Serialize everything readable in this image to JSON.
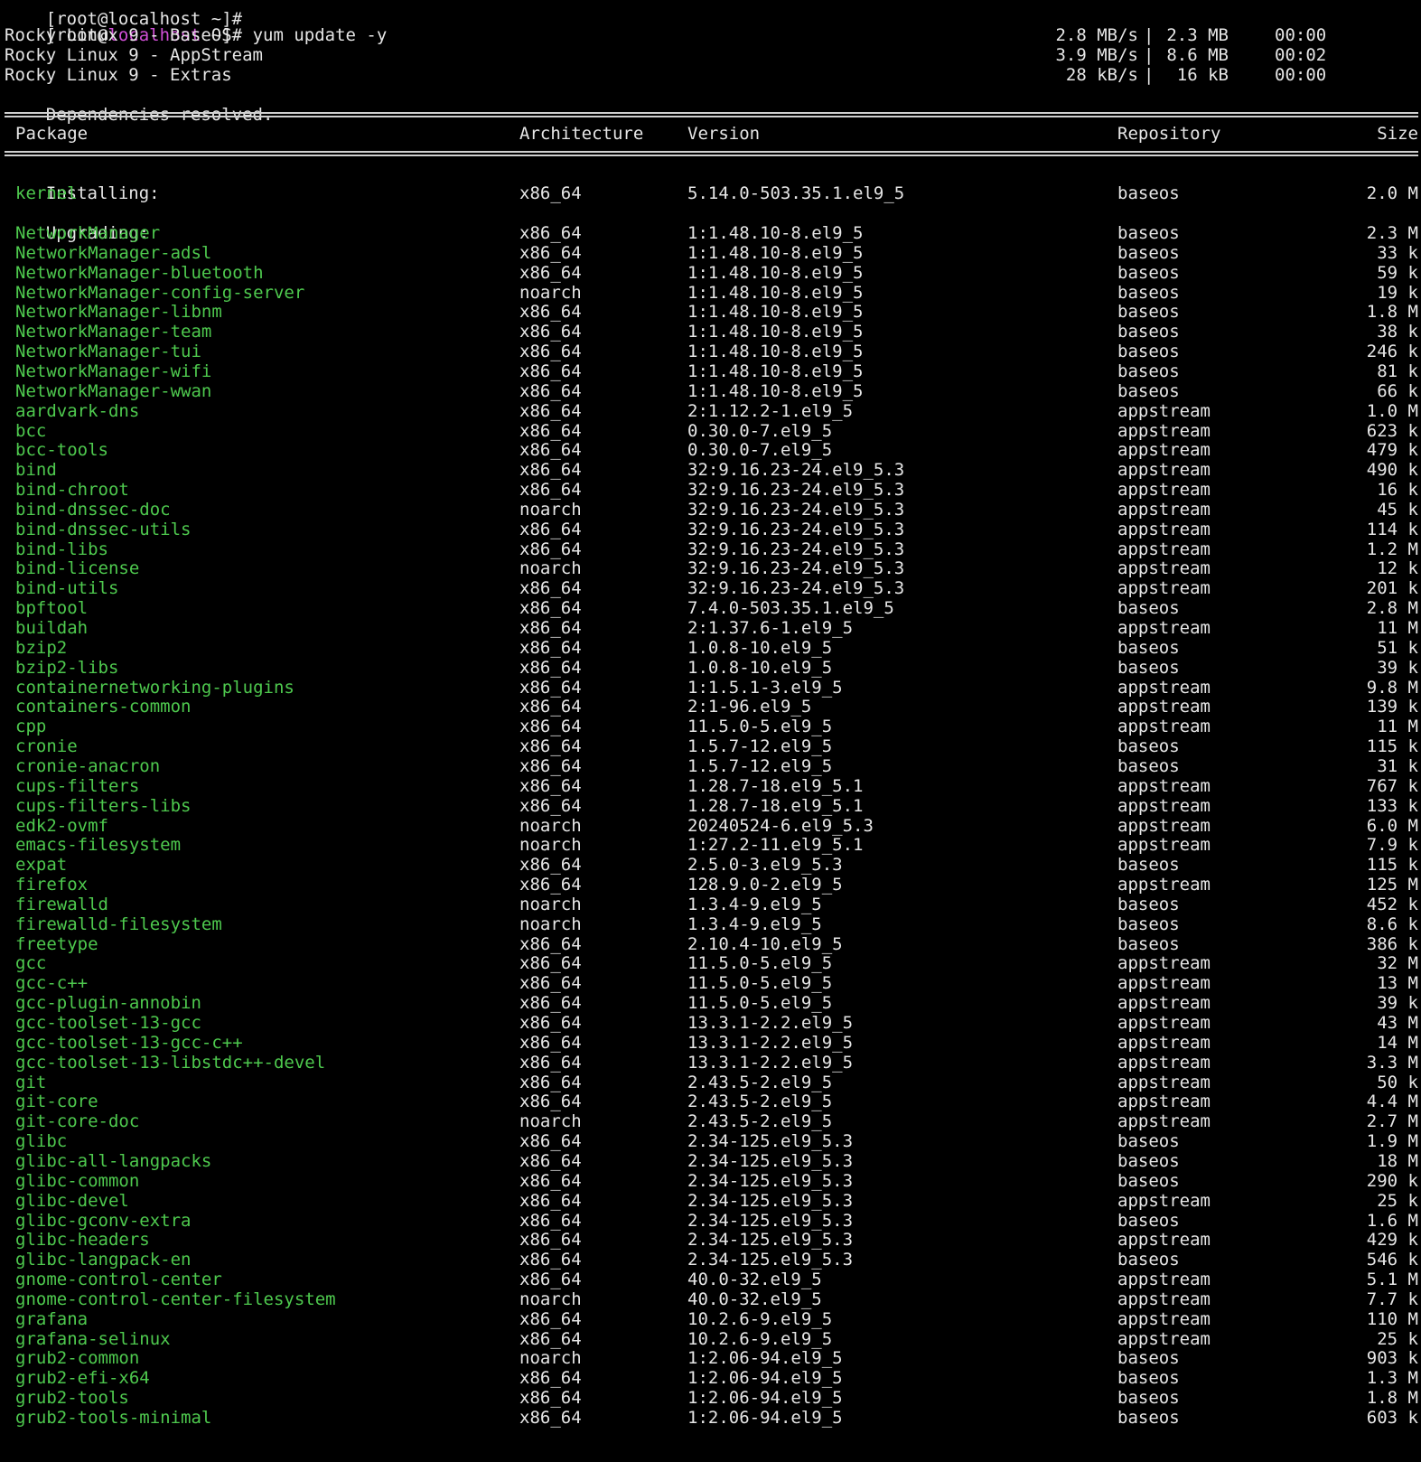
{
  "terminal": {
    "prompt_partial_top": "[root@localhost ~]#",
    "prompt": {
      "open": "[root@",
      "host": "localhost",
      "rest": " ~]# ",
      "command": "yum update -y"
    },
    "repos": [
      {
        "name": "Rocky Linux 9 - BaseOS",
        "speed": "2.8 MB/s",
        "size": "2.3 MB",
        "time": "00:00"
      },
      {
        "name": "Rocky Linux 9 - AppStream",
        "speed": "3.9 MB/s",
        "size": "8.6 MB",
        "time": "00:02"
      },
      {
        "name": "Rocky Linux 9 - Extras",
        "speed": "28 kB/s",
        "size": "16 kB",
        "time": "00:00"
      }
    ],
    "status": "Dependencies resolved.",
    "header": {
      "package": "Package",
      "arch": "Architecture",
      "version": "Version",
      "repo": "Repository",
      "size": "Size"
    },
    "section_installing": "Installing:",
    "installing": [
      {
        "name": "kernel",
        "arch": "x86_64",
        "version": "5.14.0-503.35.1.el9_5",
        "repo": "baseos",
        "size": "2.0 M"
      }
    ],
    "section_upgrading": "Upgrading:",
    "upgrading": [
      {
        "name": "NetworkManager",
        "arch": "x86_64",
        "version": "1:1.48.10-8.el9_5",
        "repo": "baseos",
        "size": "2.3 M"
      },
      {
        "name": "NetworkManager-adsl",
        "arch": "x86_64",
        "version": "1:1.48.10-8.el9_5",
        "repo": "baseos",
        "size": "33 k"
      },
      {
        "name": "NetworkManager-bluetooth",
        "arch": "x86_64",
        "version": "1:1.48.10-8.el9_5",
        "repo": "baseos",
        "size": "59 k"
      },
      {
        "name": "NetworkManager-config-server",
        "arch": "noarch",
        "version": "1:1.48.10-8.el9_5",
        "repo": "baseos",
        "size": "19 k"
      },
      {
        "name": "NetworkManager-libnm",
        "arch": "x86_64",
        "version": "1:1.48.10-8.el9_5",
        "repo": "baseos",
        "size": "1.8 M"
      },
      {
        "name": "NetworkManager-team",
        "arch": "x86_64",
        "version": "1:1.48.10-8.el9_5",
        "repo": "baseos",
        "size": "38 k"
      },
      {
        "name": "NetworkManager-tui",
        "arch": "x86_64",
        "version": "1:1.48.10-8.el9_5",
        "repo": "baseos",
        "size": "246 k"
      },
      {
        "name": "NetworkManager-wifi",
        "arch": "x86_64",
        "version": "1:1.48.10-8.el9_5",
        "repo": "baseos",
        "size": "81 k"
      },
      {
        "name": "NetworkManager-wwan",
        "arch": "x86_64",
        "version": "1:1.48.10-8.el9_5",
        "repo": "baseos",
        "size": "66 k"
      },
      {
        "name": "aardvark-dns",
        "arch": "x86_64",
        "version": "2:1.12.2-1.el9_5",
        "repo": "appstream",
        "size": "1.0 M"
      },
      {
        "name": "bcc",
        "arch": "x86_64",
        "version": "0.30.0-7.el9_5",
        "repo": "appstream",
        "size": "623 k"
      },
      {
        "name": "bcc-tools",
        "arch": "x86_64",
        "version": "0.30.0-7.el9_5",
        "repo": "appstream",
        "size": "479 k"
      },
      {
        "name": "bind",
        "arch": "x86_64",
        "version": "32:9.16.23-24.el9_5.3",
        "repo": "appstream",
        "size": "490 k"
      },
      {
        "name": "bind-chroot",
        "arch": "x86_64",
        "version": "32:9.16.23-24.el9_5.3",
        "repo": "appstream",
        "size": "16 k"
      },
      {
        "name": "bind-dnssec-doc",
        "arch": "noarch",
        "version": "32:9.16.23-24.el9_5.3",
        "repo": "appstream",
        "size": "45 k"
      },
      {
        "name": "bind-dnssec-utils",
        "arch": "x86_64",
        "version": "32:9.16.23-24.el9_5.3",
        "repo": "appstream",
        "size": "114 k"
      },
      {
        "name": "bind-libs",
        "arch": "x86_64",
        "version": "32:9.16.23-24.el9_5.3",
        "repo": "appstream",
        "size": "1.2 M"
      },
      {
        "name": "bind-license",
        "arch": "noarch",
        "version": "32:9.16.23-24.el9_5.3",
        "repo": "appstream",
        "size": "12 k"
      },
      {
        "name": "bind-utils",
        "arch": "x86_64",
        "version": "32:9.16.23-24.el9_5.3",
        "repo": "appstream",
        "size": "201 k"
      },
      {
        "name": "bpftool",
        "arch": "x86_64",
        "version": "7.4.0-503.35.1.el9_5",
        "repo": "baseos",
        "size": "2.8 M"
      },
      {
        "name": "buildah",
        "arch": "x86_64",
        "version": "2:1.37.6-1.el9_5",
        "repo": "appstream",
        "size": "11 M"
      },
      {
        "name": "bzip2",
        "arch": "x86_64",
        "version": "1.0.8-10.el9_5",
        "repo": "baseos",
        "size": "51 k"
      },
      {
        "name": "bzip2-libs",
        "arch": "x86_64",
        "version": "1.0.8-10.el9_5",
        "repo": "baseos",
        "size": "39 k"
      },
      {
        "name": "containernetworking-plugins",
        "arch": "x86_64",
        "version": "1:1.5.1-3.el9_5",
        "repo": "appstream",
        "size": "9.8 M"
      },
      {
        "name": "containers-common",
        "arch": "x86_64",
        "version": "2:1-96.el9_5",
        "repo": "appstream",
        "size": "139 k"
      },
      {
        "name": "cpp",
        "arch": "x86_64",
        "version": "11.5.0-5.el9_5",
        "repo": "appstream",
        "size": "11 M"
      },
      {
        "name": "cronie",
        "arch": "x86_64",
        "version": "1.5.7-12.el9_5",
        "repo": "baseos",
        "size": "115 k"
      },
      {
        "name": "cronie-anacron",
        "arch": "x86_64",
        "version": "1.5.7-12.el9_5",
        "repo": "baseos",
        "size": "31 k"
      },
      {
        "name": "cups-filters",
        "arch": "x86_64",
        "version": "1.28.7-18.el9_5.1",
        "repo": "appstream",
        "size": "767 k"
      },
      {
        "name": "cups-filters-libs",
        "arch": "x86_64",
        "version": "1.28.7-18.el9_5.1",
        "repo": "appstream",
        "size": "133 k"
      },
      {
        "name": "edk2-ovmf",
        "arch": "noarch",
        "version": "20240524-6.el9_5.3",
        "repo": "appstream",
        "size": "6.0 M"
      },
      {
        "name": "emacs-filesystem",
        "arch": "noarch",
        "version": "1:27.2-11.el9_5.1",
        "repo": "appstream",
        "size": "7.9 k"
      },
      {
        "name": "expat",
        "arch": "x86_64",
        "version": "2.5.0-3.el9_5.3",
        "repo": "baseos",
        "size": "115 k"
      },
      {
        "name": "firefox",
        "arch": "x86_64",
        "version": "128.9.0-2.el9_5",
        "repo": "appstream",
        "size": "125 M"
      },
      {
        "name": "firewalld",
        "arch": "noarch",
        "version": "1.3.4-9.el9_5",
        "repo": "baseos",
        "size": "452 k"
      },
      {
        "name": "firewalld-filesystem",
        "arch": "noarch",
        "version": "1.3.4-9.el9_5",
        "repo": "baseos",
        "size": "8.6 k"
      },
      {
        "name": "freetype",
        "arch": "x86_64",
        "version": "2.10.4-10.el9_5",
        "repo": "baseos",
        "size": "386 k"
      },
      {
        "name": "gcc",
        "arch": "x86_64",
        "version": "11.5.0-5.el9_5",
        "repo": "appstream",
        "size": "32 M"
      },
      {
        "name": "gcc-c++",
        "arch": "x86_64",
        "version": "11.5.0-5.el9_5",
        "repo": "appstream",
        "size": "13 M"
      },
      {
        "name": "gcc-plugin-annobin",
        "arch": "x86_64",
        "version": "11.5.0-5.el9_5",
        "repo": "appstream",
        "size": "39 k"
      },
      {
        "name": "gcc-toolset-13-gcc",
        "arch": "x86_64",
        "version": "13.3.1-2.2.el9_5",
        "repo": "appstream",
        "size": "43 M"
      },
      {
        "name": "gcc-toolset-13-gcc-c++",
        "arch": "x86_64",
        "version": "13.3.1-2.2.el9_5",
        "repo": "appstream",
        "size": "14 M"
      },
      {
        "name": "gcc-toolset-13-libstdc++-devel",
        "arch": "x86_64",
        "version": "13.3.1-2.2.el9_5",
        "repo": "appstream",
        "size": "3.3 M"
      },
      {
        "name": "git",
        "arch": "x86_64",
        "version": "2.43.5-2.el9_5",
        "repo": "appstream",
        "size": "50 k"
      },
      {
        "name": "git-core",
        "arch": "x86_64",
        "version": "2.43.5-2.el9_5",
        "repo": "appstream",
        "size": "4.4 M"
      },
      {
        "name": "git-core-doc",
        "arch": "noarch",
        "version": "2.43.5-2.el9_5",
        "repo": "appstream",
        "size": "2.7 M"
      },
      {
        "name": "glibc",
        "arch": "x86_64",
        "version": "2.34-125.el9_5.3",
        "repo": "baseos",
        "size": "1.9 M"
      },
      {
        "name": "glibc-all-langpacks",
        "arch": "x86_64",
        "version": "2.34-125.el9_5.3",
        "repo": "baseos",
        "size": "18 M"
      },
      {
        "name": "glibc-common",
        "arch": "x86_64",
        "version": "2.34-125.el9_5.3",
        "repo": "baseos",
        "size": "290 k"
      },
      {
        "name": "glibc-devel",
        "arch": "x86_64",
        "version": "2.34-125.el9_5.3",
        "repo": "appstream",
        "size": "25 k"
      },
      {
        "name": "glibc-gconv-extra",
        "arch": "x86_64",
        "version": "2.34-125.el9_5.3",
        "repo": "baseos",
        "size": "1.6 M"
      },
      {
        "name": "glibc-headers",
        "arch": "x86_64",
        "version": "2.34-125.el9_5.3",
        "repo": "appstream",
        "size": "429 k"
      },
      {
        "name": "glibc-langpack-en",
        "arch": "x86_64",
        "version": "2.34-125.el9_5.3",
        "repo": "baseos",
        "size": "546 k"
      },
      {
        "name": "gnome-control-center",
        "arch": "x86_64",
        "version": "40.0-32.el9_5",
        "repo": "appstream",
        "size": "5.1 M"
      },
      {
        "name": "gnome-control-center-filesystem",
        "arch": "noarch",
        "version": "40.0-32.el9_5",
        "repo": "appstream",
        "size": "7.7 k"
      },
      {
        "name": "grafana",
        "arch": "x86_64",
        "version": "10.2.6-9.el9_5",
        "repo": "appstream",
        "size": "110 M"
      },
      {
        "name": "grafana-selinux",
        "arch": "x86_64",
        "version": "10.2.6-9.el9_5",
        "repo": "appstream",
        "size": "25 k"
      },
      {
        "name": "grub2-common",
        "arch": "noarch",
        "version": "1:2.06-94.el9_5",
        "repo": "baseos",
        "size": "903 k"
      },
      {
        "name": "grub2-efi-x64",
        "arch": "x86_64",
        "version": "1:2.06-94.el9_5",
        "repo": "baseos",
        "size": "1.3 M"
      },
      {
        "name": "grub2-tools",
        "arch": "x86_64",
        "version": "1:2.06-94.el9_5",
        "repo": "baseos",
        "size": "1.8 M"
      },
      {
        "name": "grub2-tools-minimal",
        "arch": "x86_64",
        "version": "1:2.06-94.el9_5",
        "repo": "baseos",
        "size": "603 k"
      }
    ],
    "colors": {
      "background": "#000000",
      "text": "#e6e6e6",
      "package_name": "#4ec94e",
      "hostname": "#d14fd6"
    }
  }
}
